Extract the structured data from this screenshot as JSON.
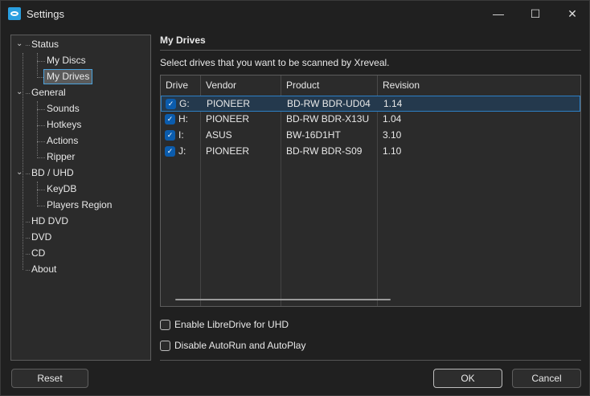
{
  "window": {
    "title": "Settings",
    "minimize": "—",
    "maximize": "☐",
    "close": "✕"
  },
  "tree": {
    "items": [
      {
        "label": "Status",
        "level": 0,
        "expanded": true
      },
      {
        "label": "My Discs",
        "level": 1
      },
      {
        "label": "My Drives",
        "level": 1,
        "selected": true
      },
      {
        "label": "General",
        "level": 0,
        "expanded": true
      },
      {
        "label": "Sounds",
        "level": 1
      },
      {
        "label": "Hotkeys",
        "level": 1
      },
      {
        "label": "Actions",
        "level": 1
      },
      {
        "label": "Ripper",
        "level": 1
      },
      {
        "label": "BD / UHD",
        "level": 0,
        "expanded": true
      },
      {
        "label": "KeyDB",
        "level": 1
      },
      {
        "label": "Players Region",
        "level": 1
      },
      {
        "label": "HD DVD",
        "level": 0
      },
      {
        "label": "DVD",
        "level": 0
      },
      {
        "label": "CD",
        "level": 0
      },
      {
        "label": "About",
        "level": 0
      }
    ]
  },
  "main": {
    "title": "My Drives",
    "description": "Select drives that you want to be scanned by Xreveal.",
    "table": {
      "headers": [
        "Drive",
        "Vendor",
        "Product",
        "Revision"
      ],
      "rows": [
        {
          "checked": true,
          "drive": "G:",
          "vendor": "PIONEER",
          "product": "BD-RW BDR-UD04",
          "revision": "1.14",
          "selected": true
        },
        {
          "checked": true,
          "drive": "H:",
          "vendor": "PIONEER",
          "product": "BD-RW BDR-X13U",
          "revision": "1.04"
        },
        {
          "checked": true,
          "drive": "I:",
          "vendor": "ASUS",
          "product": "BW-16D1HT",
          "revision": "3.10"
        },
        {
          "checked": true,
          "drive": "J:",
          "vendor": "PIONEER",
          "product": "BD-RW BDR-S09",
          "revision": "1.10"
        }
      ]
    },
    "options": [
      {
        "label": "Enable LibreDrive for UHD",
        "checked": false
      },
      {
        "label": "Disable AutoRun and AutoPlay",
        "checked": false
      }
    ]
  },
  "buttons": {
    "reset": "Reset",
    "ok": "OK",
    "cancel": "Cancel"
  },
  "check_glyph": "✓"
}
